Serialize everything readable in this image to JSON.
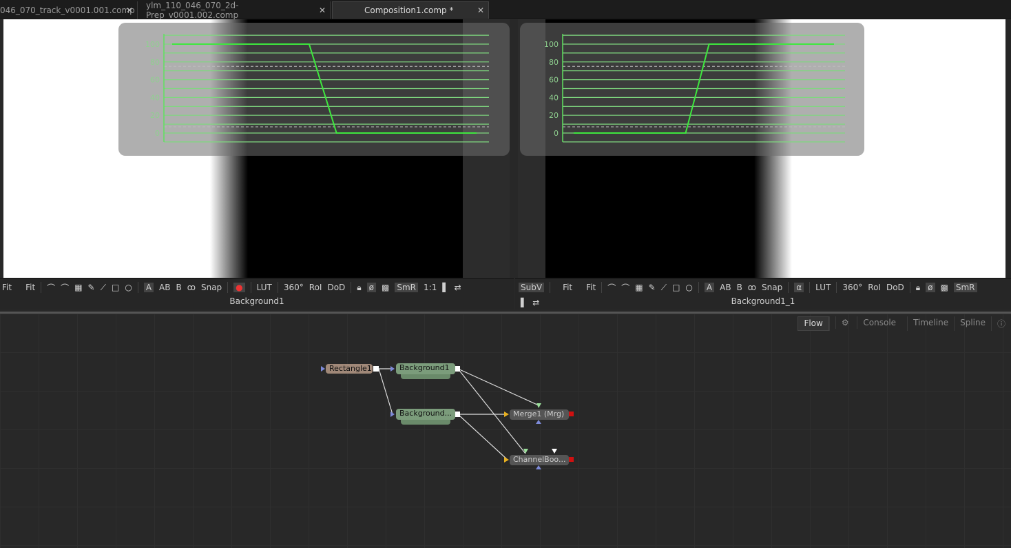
{
  "tabs": [
    {
      "label": "046_070_track_v0001.001.comp",
      "active": false
    },
    {
      "label": "ylm_110_046_070_2d-Prep_v0001.002.comp",
      "active": false
    },
    {
      "label": "Composition1.comp *",
      "active": true
    }
  ],
  "close_glyph": "✕",
  "viewers": [
    {
      "name": "Background1",
      "toolbar": [
        "Fit",
        "Fit",
        "Snap",
        "LUT",
        "360°",
        "RoI",
        "DoD",
        "SmR",
        "1:1"
      ],
      "toolbar_buttons": {
        "a": "A",
        "ab": "AB",
        "b": "B"
      }
    },
    {
      "name": "Background1_1",
      "toolbar": [
        "SubV",
        "Fit",
        "Fit",
        "Snap",
        "LUT",
        "360°",
        "RoI",
        "DoD",
        "SmR"
      ],
      "toolbar_buttons": {
        "a": "A",
        "ab": "AB",
        "b": "B",
        "alpha": "α"
      }
    }
  ],
  "chart_data": [
    {
      "type": "line",
      "yticks": [
        0,
        20,
        40,
        60,
        80,
        100
      ],
      "ylim": [
        -10,
        110
      ],
      "grid": true,
      "dashed_levels": [
        75,
        7
      ],
      "color": "#3ee83e",
      "points": [
        [
          0,
          100
        ],
        [
          0.45,
          100
        ],
        [
          0.54,
          0
        ],
        [
          1,
          0
        ]
      ]
    },
    {
      "type": "line",
      "yticks": [
        0,
        20,
        40,
        60,
        80,
        100
      ],
      "ylim": [
        -10,
        110
      ],
      "grid": true,
      "dashed_levels": [
        75,
        7
      ],
      "color": "#3ee83e",
      "points": [
        [
          0,
          0
        ],
        [
          0.43,
          0
        ],
        [
          0.52,
          100
        ],
        [
          1,
          100
        ]
      ]
    }
  ],
  "flow_tabs": [
    "Flow",
    "Console",
    "Timeline",
    "Spline"
  ],
  "nodes": {
    "rect": "Rectangle1",
    "bg1": "Background1",
    "bg2": "Background...",
    "merge": "Merge1  (Mrg)",
    "cb": "ChannelBoo..."
  },
  "colors": {
    "accent": "#3ee83e",
    "bg_node": "#7a9a7a",
    "rect_node": "#9a8070",
    "tool_node": "#555555"
  }
}
